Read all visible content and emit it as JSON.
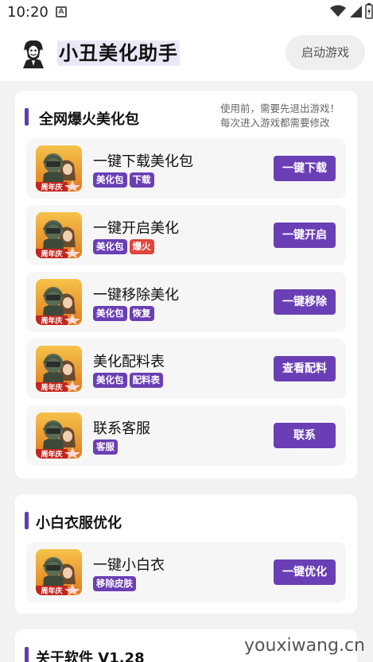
{
  "status": {
    "time": "10:20",
    "a_icon": "A"
  },
  "header": {
    "title": "小丑美化助手",
    "launch_label": "启动游戏",
    "avatar_icon": "joker-avatar"
  },
  "section1": {
    "title": "全网爆火美化包",
    "note_line1": "使用前，需要先退出游戏！",
    "note_line2": "每次进入游戏都需要修改",
    "rows": [
      {
        "title": "一键下载美化包",
        "tags": [
          "美化包",
          "下载"
        ],
        "button": "一键下载"
      },
      {
        "title": "一键开启美化",
        "tags": [
          "美化包",
          "爆火"
        ],
        "button": "一键开启"
      },
      {
        "title": "一键移除美化",
        "tags": [
          "美化包",
          "恢复"
        ],
        "button": "一键移除"
      },
      {
        "title": "美化配料表",
        "tags": [
          "美化包",
          "配料表"
        ],
        "button": "查看配料"
      },
      {
        "title": "联系客服",
        "tags": [
          "客服"
        ],
        "button": "联系"
      }
    ]
  },
  "section2": {
    "title": "小白衣服优化",
    "rows": [
      {
        "title": "一键小白衣",
        "tags": [
          "移除皮肤"
        ],
        "button": "一键优化"
      }
    ]
  },
  "section3": {
    "title": "关于软件 V1.28"
  },
  "game_icon_badge": "周年庆",
  "watermark": "youxiwang.cn",
  "colors": {
    "accent": "#6a3fb5",
    "hot": "#e0453a"
  }
}
